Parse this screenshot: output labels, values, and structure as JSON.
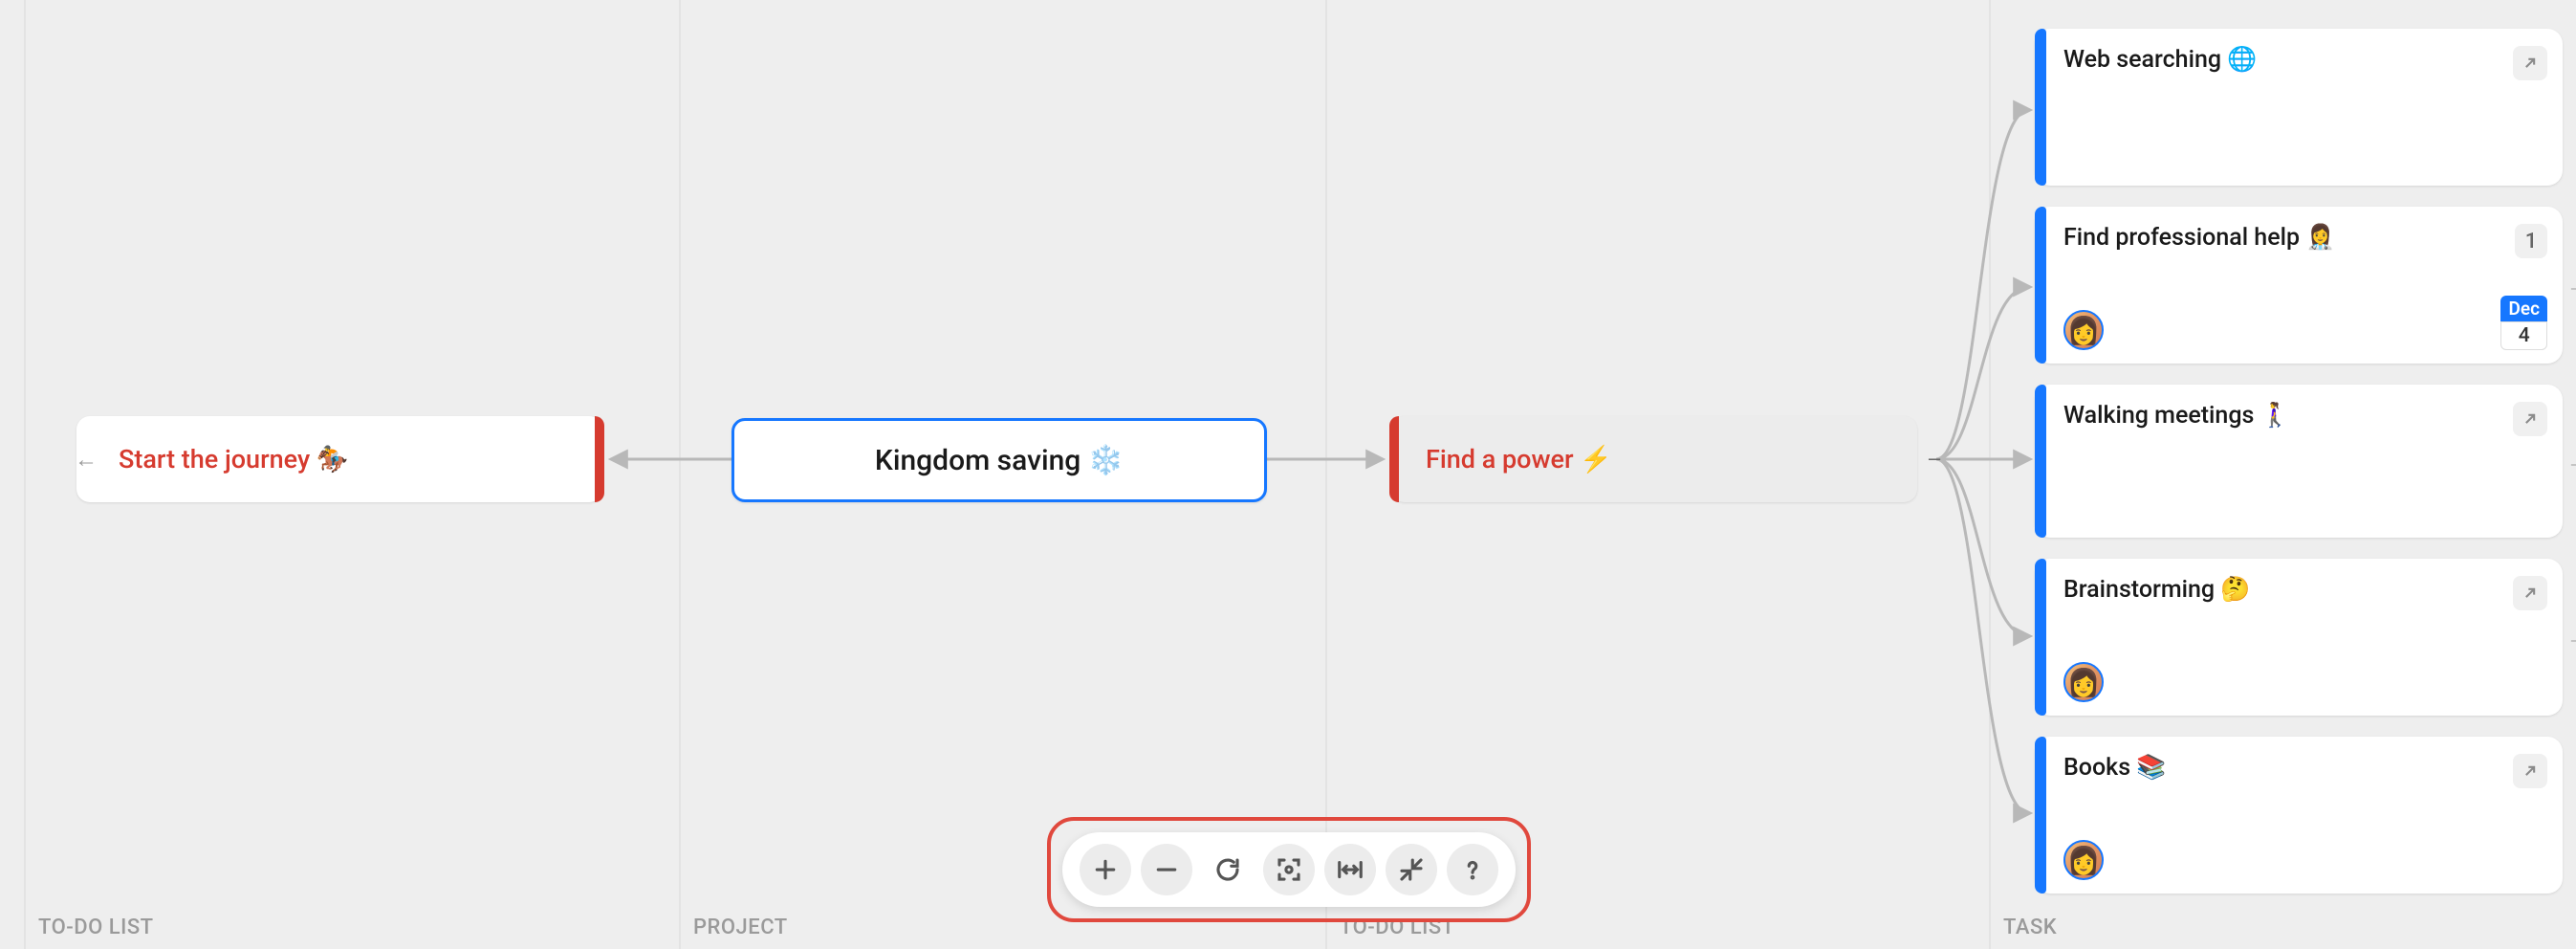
{
  "columns": {
    "todo_left_label": "TO-DO LIST",
    "project_label": "PROJECT",
    "todo_right_label": "TO-DO LIST",
    "task_label": "TASK"
  },
  "nodes": {
    "start_journey": {
      "title": "Start the journey 🏇"
    },
    "kingdom_saving": {
      "title": "Kingdom saving ❄️"
    },
    "find_power": {
      "title": "Find a power ⚡"
    }
  },
  "tasks": [
    {
      "title": "Web searching 🌐",
      "expand": true
    },
    {
      "title": "Find professional help 👩‍⚕️",
      "count": "1",
      "avatar": true,
      "date_month": "Dec",
      "date_day": "4"
    },
    {
      "title": "Walking meetings 🚶‍♀️",
      "expand": true
    },
    {
      "title": "Brainstorming 🤔",
      "expand": true,
      "avatar": true
    },
    {
      "title": "Books 📚",
      "expand": true,
      "avatar": true
    }
  ],
  "toolbar": {
    "zoom_in": "zoom-in",
    "zoom_out": "zoom-out",
    "reset": "reset-view",
    "focus": "focus-center",
    "fit_width": "fit-width",
    "collapse": "collapse-all",
    "help": "help"
  }
}
